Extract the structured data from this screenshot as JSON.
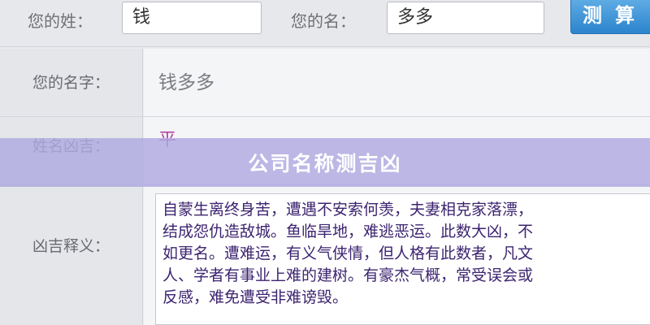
{
  "form": {
    "surname_label": "您的姓：",
    "surname_value": "钱",
    "given_label": "您的名：",
    "given_value": "多多",
    "submit_label": "测算"
  },
  "result": {
    "name_label": "您的名字：",
    "name_value": "钱多多",
    "fortune_label": "姓名凶吉：",
    "fortune_value": "平",
    "meaning_label": "凶吉释义：",
    "meaning_lines": [
      "自蒙生离终身苦，遭遇不安索何羡，夫妻相克家落漂，",
      "结成怨仇造敌城。鱼临旱地，难逃恶运。此数大凶，不",
      "如更名。遭难运，有义气侠情，但人格有此数者，凡文",
      "人、学者有事业上难的建树。有豪杰气概，常受误会或",
      "反感，难免遭受非难谤毁。"
    ]
  },
  "banner": {
    "title": "公司名称测吉凶"
  },
  "colors": {
    "banner_overlay": "#b0aae1",
    "fortune_text": "#b3409d",
    "meaning_text": "#3c2470",
    "button": "#2b84cc"
  }
}
